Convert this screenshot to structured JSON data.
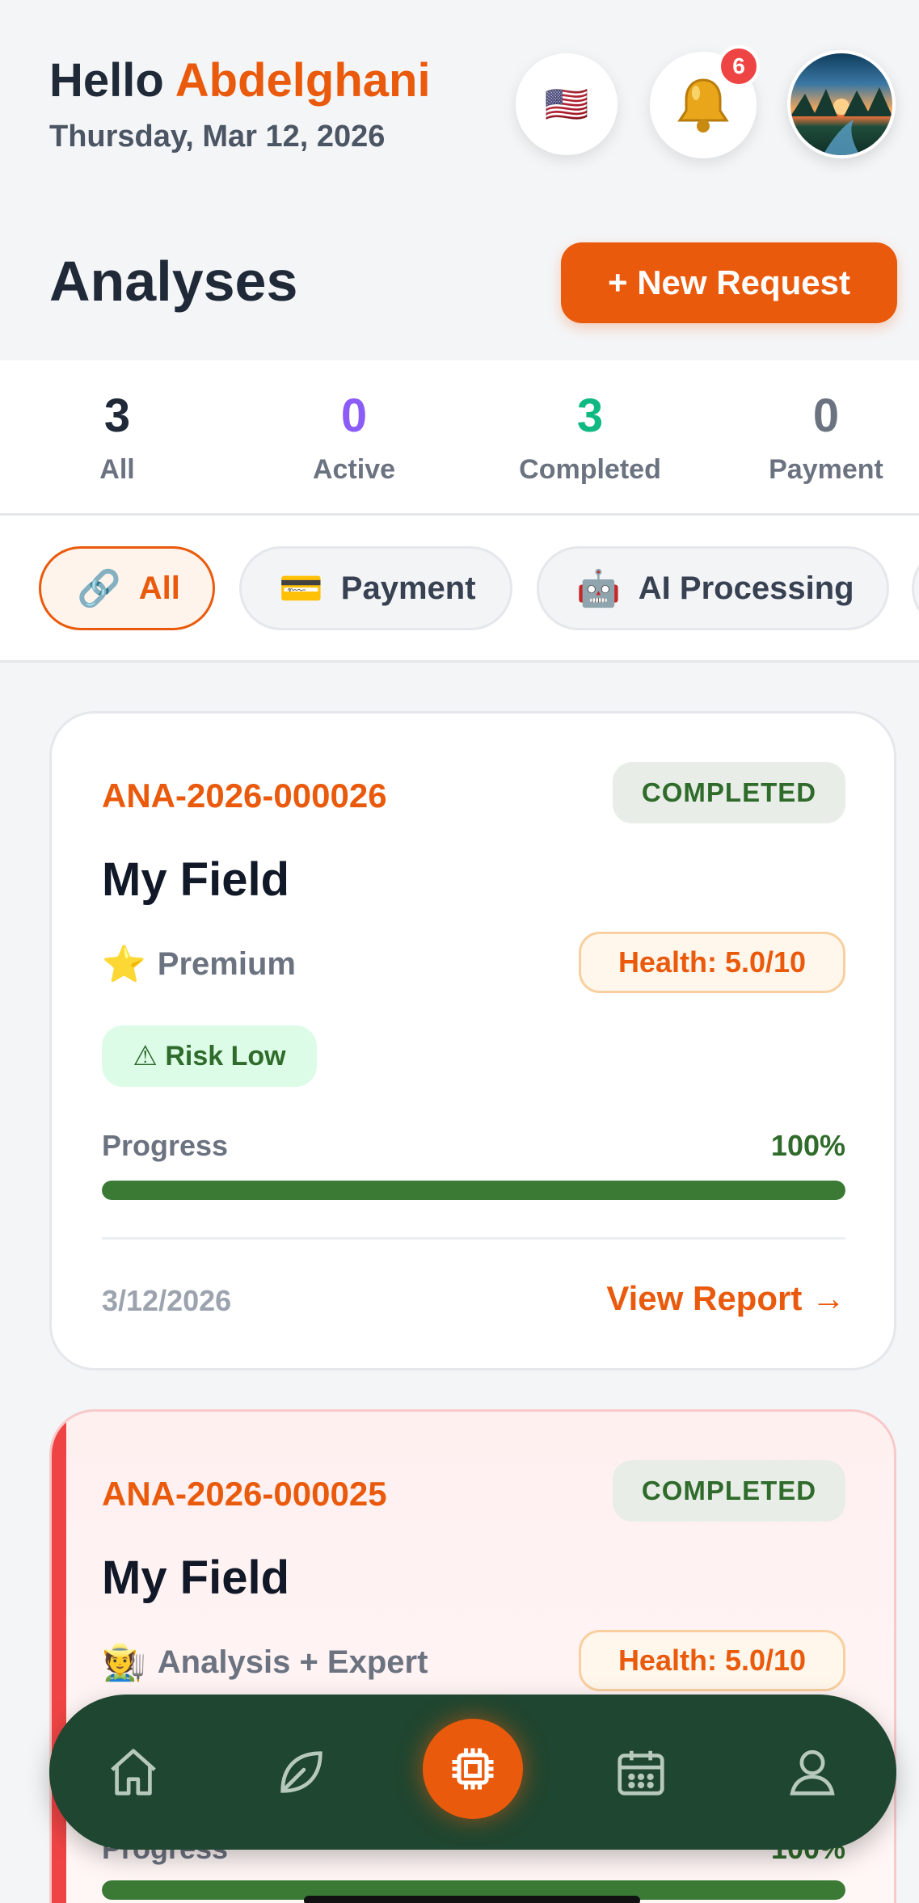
{
  "header": {
    "greeting": "Hello",
    "user_name": "Abdelghani",
    "date": "Thursday, Mar 12, 2026",
    "language_flag": "🇺🇸",
    "notification_count": "6"
  },
  "page": {
    "title": "Analyses",
    "new_request_label": "+ New Request"
  },
  "stats": [
    {
      "value": "3",
      "label": "All",
      "color": "#1f2937"
    },
    {
      "value": "0",
      "label": "Active",
      "color": "#8b5cf6"
    },
    {
      "value": "3",
      "label": "Completed",
      "color": "#10b981"
    },
    {
      "value": "0",
      "label": "Payment",
      "color": "#6b7280"
    }
  ],
  "filters": [
    {
      "icon": "🔗",
      "label": "All",
      "active": true
    },
    {
      "icon": "💳",
      "label": "Payment",
      "active": false
    },
    {
      "icon": "🤖",
      "label": "AI Processing",
      "active": false
    }
  ],
  "analyses": [
    {
      "code": "ANA-2026-000026",
      "status": "COMPLETED",
      "field": "My Field",
      "plan_icon": "⭐",
      "plan": "Premium",
      "health": "Health: 5.0/10",
      "risk": "⚠ Risk Low",
      "progress_label": "Progress",
      "progress_text": "100%",
      "progress": 1.0,
      "date": "3/12/2026",
      "action": "View Report →"
    },
    {
      "code": "ANA-2026-000025",
      "status": "COMPLETED",
      "field": "My Field",
      "plan_icon": "🧑‍🌾",
      "plan": "Analysis + Expert",
      "health": "Health: 5.0/10",
      "progress_label": "Progress",
      "progress_text": "100%",
      "progress": 1.0
    }
  ],
  "nav": {
    "items": [
      "home-icon",
      "leaf-icon",
      "chip-icon",
      "calendar-icon",
      "profile-icon"
    ],
    "active": "chip-icon",
    "accent": "#ea5a0c",
    "background": "#1f4630"
  }
}
